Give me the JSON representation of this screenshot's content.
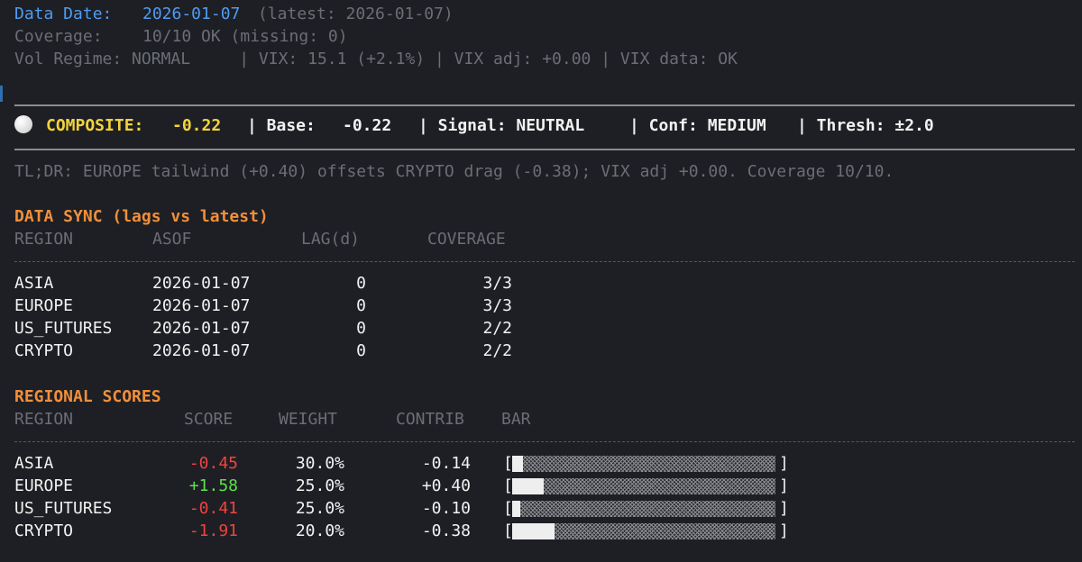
{
  "header": {
    "data_date_label": "Data Date:",
    "data_date": "2026-01-07",
    "latest": "(latest: 2026-01-07)",
    "coverage_label": "Coverage:",
    "coverage": "10/10 OK (missing: 0)",
    "vol_line": "Vol Regime: NORMAL     | VIX: 15.1 (+2.1%) | VIX adj: +0.00 | VIX data: OK"
  },
  "composite": {
    "label": "COMPOSITE:",
    "value": "-0.22",
    "base_label": "| Base:",
    "base": "-0.22",
    "signal": "| Signal: NEUTRAL",
    "conf": "| Conf: MEDIUM",
    "thresh": "| Thresh: ±2.0"
  },
  "tldr": "TL;DR: EUROPE tailwind (+0.40) offsets CRYPTO drag (-0.38); VIX adj +0.00. Coverage 10/10.",
  "data_sync": {
    "title": "DATA SYNC (lags vs latest)",
    "headers": [
      "REGION",
      "ASOF",
      "LAG(d)",
      "COVERAGE"
    ],
    "rows": [
      {
        "region": "ASIA",
        "asof": "2026-01-07",
        "lag": "0",
        "coverage": "3/3"
      },
      {
        "region": "EUROPE",
        "asof": "2026-01-07",
        "lag": "0",
        "coverage": "3/3"
      },
      {
        "region": "US_FUTURES",
        "asof": "2026-01-07",
        "lag": "0",
        "coverage": "2/2"
      },
      {
        "region": "CRYPTO",
        "asof": "2026-01-07",
        "lag": "0",
        "coverage": "2/2"
      }
    ]
  },
  "regional_scores": {
    "title": "REGIONAL SCORES",
    "headers": [
      "REGION",
      "SCORE",
      "WEIGHT",
      "CONTRIB",
      "BAR"
    ],
    "bar_open": "[",
    "bar_close": "]",
    "rows": [
      {
        "region": "ASIA",
        "score": "-0.45",
        "score_color": "#f0433e",
        "weight": "30.0%",
        "contrib": "-0.14",
        "bar_fraction": 0.04
      },
      {
        "region": "EUROPE",
        "score": "+1.58",
        "score_color": "#5ee04d",
        "weight": "25.0%",
        "contrib": "+0.40",
        "bar_fraction": 0.12
      },
      {
        "region": "US_FUTURES",
        "score": "-0.41",
        "score_color": "#f0433e",
        "weight": "25.0%",
        "contrib": "-0.10",
        "bar_fraction": 0.03
      },
      {
        "region": "CRYPTO",
        "score": "-1.91",
        "score_color": "#f0433e",
        "weight": "20.0%",
        "contrib": "-0.38",
        "bar_fraction": 0.16
      }
    ]
  }
}
